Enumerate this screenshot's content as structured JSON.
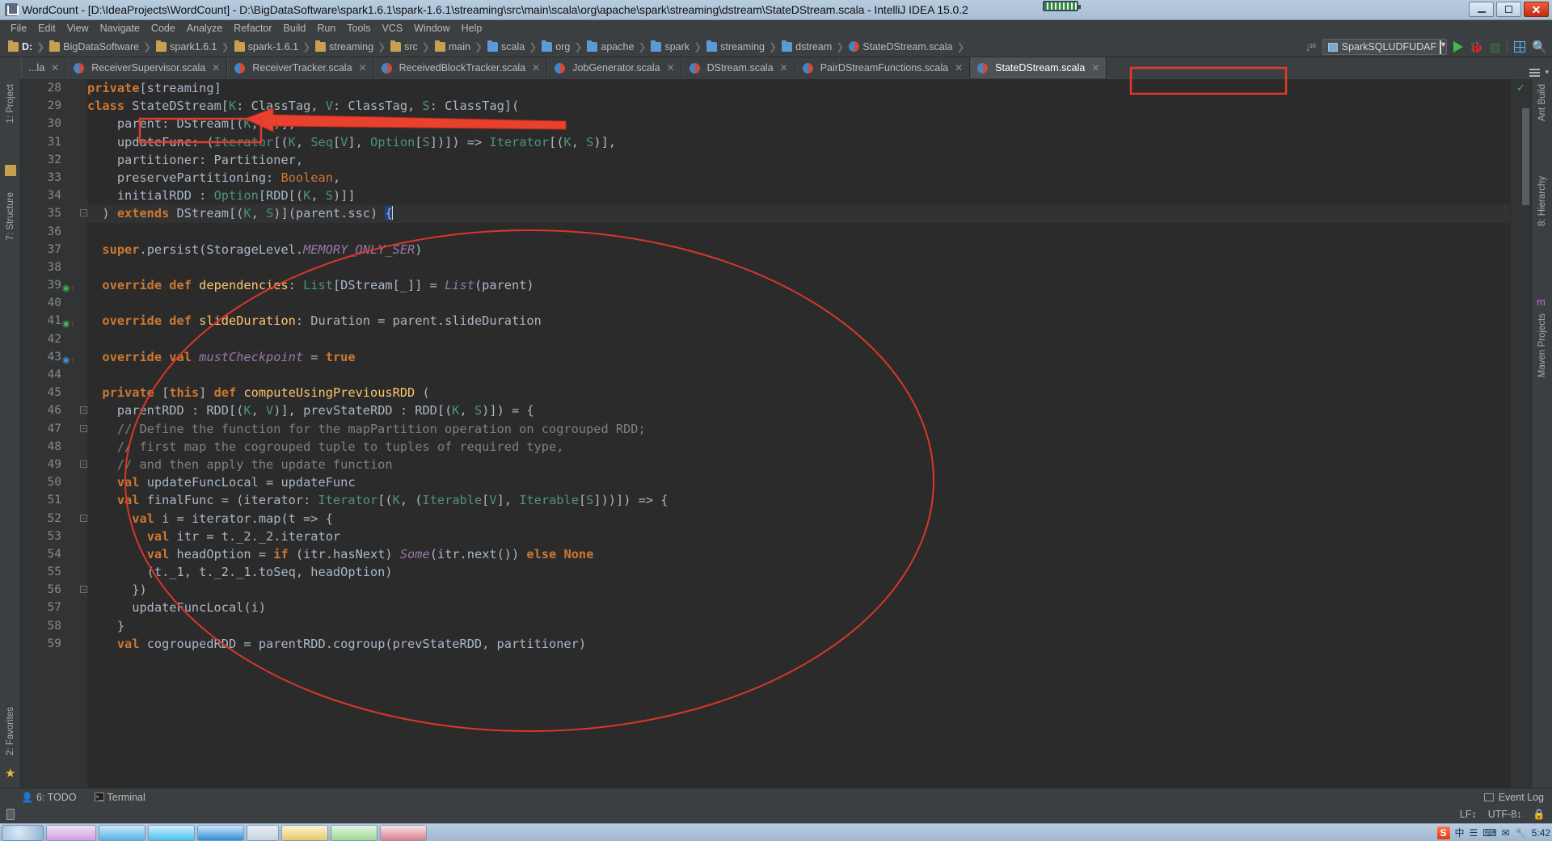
{
  "window": {
    "title": "WordCount - [D:\\IdeaProjects\\WordCount] - D:\\BigDataSoftware\\spark1.6.1\\spark-1.6.1\\streaming\\src\\main\\scala\\org\\apache\\spark\\streaming\\dstream\\StateDStream.scala - IntelliJ IDEA 15.0.2",
    "minimize_label": "Minimize",
    "maximize_label": "Maximize",
    "close_label": "Close"
  },
  "menubar": [
    {
      "label": "File"
    },
    {
      "label": "Edit"
    },
    {
      "label": "View"
    },
    {
      "label": "Navigate"
    },
    {
      "label": "Code"
    },
    {
      "label": "Analyze"
    },
    {
      "label": "Refactor"
    },
    {
      "label": "Build"
    },
    {
      "label": "Run"
    },
    {
      "label": "Tools"
    },
    {
      "label": "VCS"
    },
    {
      "label": "Window"
    },
    {
      "label": "Help"
    }
  ],
  "breadcrumbs": [
    {
      "label": "D:",
      "icon": "folder-icon",
      "kind": "folder"
    },
    {
      "label": "BigDataSoftware",
      "icon": "folder-icon",
      "kind": "folder"
    },
    {
      "label": "spark1.6.1",
      "icon": "folder-icon",
      "kind": "folder"
    },
    {
      "label": "spark-1.6.1",
      "icon": "folder-icon",
      "kind": "folder"
    },
    {
      "label": "streaming",
      "icon": "folder-icon",
      "kind": "folder"
    },
    {
      "label": "src",
      "icon": "folder-icon",
      "kind": "folder"
    },
    {
      "label": "main",
      "icon": "folder-icon",
      "kind": "folder"
    },
    {
      "label": "scala",
      "icon": "source-folder-icon",
      "kind": "src"
    },
    {
      "label": "org",
      "icon": "source-folder-icon",
      "kind": "src"
    },
    {
      "label": "apache",
      "icon": "source-folder-icon",
      "kind": "src"
    },
    {
      "label": "spark",
      "icon": "source-folder-icon",
      "kind": "src"
    },
    {
      "label": "streaming",
      "icon": "source-folder-icon",
      "kind": "src"
    },
    {
      "label": "dstream",
      "icon": "source-folder-icon",
      "kind": "src"
    },
    {
      "label": "StateDStream.scala",
      "icon": "scala-file-icon",
      "kind": "scala"
    }
  ],
  "toolbar": {
    "download_label": "10",
    "run_config": "SparkSQLUDFUDAF",
    "run_label": "Run",
    "debug_label": "Debug",
    "coverage_label": "Run with Coverage",
    "layout_label": "Toggle Layout",
    "search_label": "Search Everywhere"
  },
  "tabs": [
    {
      "label": "...la",
      "active": false,
      "truncated": true
    },
    {
      "label": "ReceiverSupervisor.scala",
      "active": false
    },
    {
      "label": "ReceiverTracker.scala",
      "active": false
    },
    {
      "label": "ReceivedBlockTracker.scala",
      "active": false
    },
    {
      "label": "JobGenerator.scala",
      "active": false
    },
    {
      "label": "DStream.scala",
      "active": false
    },
    {
      "label": "PairDStreamFunctions.scala",
      "active": false
    },
    {
      "label": "StateDStream.scala",
      "active": true
    }
  ],
  "left_tool_window": [
    {
      "label": "1: Project"
    },
    {
      "label": "7: Structure"
    },
    {
      "label": "2: Favorites"
    }
  ],
  "right_tool_window": [
    {
      "label": "Ant Build"
    },
    {
      "label": "8: Hierarchy"
    },
    {
      "label": "Maven Projects"
    }
  ],
  "editor": {
    "first_line": 28,
    "cursor_line": 35,
    "lines": [
      {
        "n": 28,
        "mark": "",
        "fold": "",
        "tokens": [
          {
            "t": "private",
            "c": "kw"
          },
          {
            "t": "[streaming]",
            "c": "pl"
          }
        ]
      },
      {
        "n": 29,
        "mark": "",
        "fold": "",
        "tokens": [
          {
            "t": "class ",
            "c": "kw"
          },
          {
            "t": "StateDStream",
            "c": "pl"
          },
          {
            "t": "[",
            "c": "pl"
          },
          {
            "t": "K",
            "c": "ty"
          },
          {
            "t": ": ClassTag, ",
            "c": "pl"
          },
          {
            "t": "V",
            "c": "ty"
          },
          {
            "t": ": ClassTag, ",
            "c": "pl"
          },
          {
            "t": "S",
            "c": "ty"
          },
          {
            "t": ": ClassTag](",
            "c": "pl"
          }
        ]
      },
      {
        "n": 30,
        "mark": "",
        "fold": "",
        "tokens": [
          {
            "t": "    parent: DStream[(",
            "c": "pl"
          },
          {
            "t": "K",
            "c": "ty"
          },
          {
            "t": ", ",
            "c": "pl"
          },
          {
            "t": "V",
            "c": "ty"
          },
          {
            "t": ")],",
            "c": "pl"
          }
        ]
      },
      {
        "n": 31,
        "mark": "",
        "fold": "",
        "tokens": [
          {
            "t": "    updateFunc: (",
            "c": "pl"
          },
          {
            "t": "Iterator",
            "c": "ty"
          },
          {
            "t": "[(",
            "c": "pl"
          },
          {
            "t": "K",
            "c": "ty"
          },
          {
            "t": ", ",
            "c": "pl"
          },
          {
            "t": "Seq",
            "c": "ty"
          },
          {
            "t": "[",
            "c": "pl"
          },
          {
            "t": "V",
            "c": "ty"
          },
          {
            "t": "], ",
            "c": "pl"
          },
          {
            "t": "Option",
            "c": "ty"
          },
          {
            "t": "[",
            "c": "pl"
          },
          {
            "t": "S",
            "c": "ty"
          },
          {
            "t": "])]) => ",
            "c": "pl"
          },
          {
            "t": "Iterator",
            "c": "ty"
          },
          {
            "t": "[(",
            "c": "pl"
          },
          {
            "t": "K",
            "c": "ty"
          },
          {
            "t": ", ",
            "c": "pl"
          },
          {
            "t": "S",
            "c": "ty"
          },
          {
            "t": ")],",
            "c": "pl"
          }
        ]
      },
      {
        "n": 32,
        "mark": "",
        "fold": "",
        "tokens": [
          {
            "t": "    partitioner: Partitioner,",
            "c": "pl"
          }
        ]
      },
      {
        "n": 33,
        "mark": "",
        "fold": "",
        "tokens": [
          {
            "t": "    preservePartitioning: ",
            "c": "pl"
          },
          {
            "t": "Boolean",
            "c": "kw2"
          },
          {
            "t": ",",
            "c": "pl"
          }
        ]
      },
      {
        "n": 34,
        "mark": "",
        "fold": "",
        "tokens": [
          {
            "t": "    initialRDD : ",
            "c": "pl"
          },
          {
            "t": "Option",
            "c": "ty"
          },
          {
            "t": "[RDD[(",
            "c": "pl"
          },
          {
            "t": "K",
            "c": "ty"
          },
          {
            "t": ", ",
            "c": "pl"
          },
          {
            "t": "S",
            "c": "ty"
          },
          {
            "t": ")]]",
            "c": "pl"
          }
        ]
      },
      {
        "n": 35,
        "mark": "",
        "fold": "minus",
        "tokens": [
          {
            "t": "  ) ",
            "c": "pl"
          },
          {
            "t": "extends",
            "c": "kw"
          },
          {
            "t": " DStream[(",
            "c": "pl"
          },
          {
            "t": "K",
            "c": "ty"
          },
          {
            "t": ", ",
            "c": "pl"
          },
          {
            "t": "S",
            "c": "ty"
          },
          {
            "t": ")](parent.ssc) ",
            "c": "pl"
          },
          {
            "t": "{",
            "c": "sel"
          }
        ]
      },
      {
        "n": 36,
        "mark": "",
        "fold": "",
        "tokens": []
      },
      {
        "n": 37,
        "mark": "",
        "fold": "",
        "tokens": [
          {
            "t": "  ",
            "c": "pl"
          },
          {
            "t": "super",
            "c": "kw"
          },
          {
            "t": ".persist(StorageLevel.",
            "c": "pl"
          },
          {
            "t": "MEMORY_ONLY_SER",
            "c": "fld"
          },
          {
            "t": ")",
            "c": "pl"
          }
        ]
      },
      {
        "n": 38,
        "mark": "",
        "fold": "",
        "tokens": []
      },
      {
        "n": 39,
        "mark": "override",
        "fold": "",
        "tokens": [
          {
            "t": "  ",
            "c": "pl"
          },
          {
            "t": "override def",
            "c": "kw"
          },
          {
            "t": " ",
            "c": "pl"
          },
          {
            "t": "dependencies",
            "c": "fn"
          },
          {
            "t": ": ",
            "c": "pl"
          },
          {
            "t": "List",
            "c": "ty"
          },
          {
            "t": "[DStream[_]] = ",
            "c": "pl"
          },
          {
            "t": "List",
            "c": "obj"
          },
          {
            "t": "(parent)",
            "c": "pl"
          }
        ]
      },
      {
        "n": 40,
        "mark": "",
        "fold": "",
        "tokens": []
      },
      {
        "n": 41,
        "mark": "override",
        "fold": "",
        "tokens": [
          {
            "t": "  ",
            "c": "pl"
          },
          {
            "t": "override def",
            "c": "kw"
          },
          {
            "t": " ",
            "c": "pl"
          },
          {
            "t": "slideDuration",
            "c": "fn"
          },
          {
            "t": ": Duration = parent.slideDuration",
            "c": "pl"
          }
        ]
      },
      {
        "n": 42,
        "mark": "",
        "fold": "",
        "tokens": []
      },
      {
        "n": 43,
        "mark": "override-val",
        "fold": "",
        "tokens": [
          {
            "t": "  ",
            "c": "pl"
          },
          {
            "t": "override val",
            "c": "kw"
          },
          {
            "t": " ",
            "c": "pl"
          },
          {
            "t": "mustCheckpoint",
            "c": "fld"
          },
          {
            "t": " = ",
            "c": "pl"
          },
          {
            "t": "true",
            "c": "kw"
          }
        ]
      },
      {
        "n": 44,
        "mark": "",
        "fold": "",
        "tokens": []
      },
      {
        "n": 45,
        "mark": "",
        "fold": "",
        "tokens": [
          {
            "t": "  ",
            "c": "pl"
          },
          {
            "t": "private",
            "c": "kw"
          },
          {
            "t": " [",
            "c": "pl"
          },
          {
            "t": "this",
            "c": "kw"
          },
          {
            "t": "] ",
            "c": "pl"
          },
          {
            "t": "def",
            "c": "kw"
          },
          {
            "t": " ",
            "c": "pl"
          },
          {
            "t": "computeUsingPreviousRDD",
            "c": "fn"
          },
          {
            "t": " (",
            "c": "pl"
          }
        ]
      },
      {
        "n": 46,
        "mark": "",
        "fold": "minus",
        "tokens": [
          {
            "t": "    parentRDD : RDD[(",
            "c": "pl"
          },
          {
            "t": "K",
            "c": "ty"
          },
          {
            "t": ", ",
            "c": "pl"
          },
          {
            "t": "V",
            "c": "ty"
          },
          {
            "t": ")], prevStateRDD : RDD[(",
            "c": "pl"
          },
          {
            "t": "K",
            "c": "ty"
          },
          {
            "t": ", ",
            "c": "pl"
          },
          {
            "t": "S",
            "c": "ty"
          },
          {
            "t": ")]) = {",
            "c": "pl"
          }
        ]
      },
      {
        "n": 47,
        "mark": "",
        "fold": "minus",
        "tokens": [
          {
            "t": "    // Define the function for the mapPartition operation on cogrouped RDD;",
            "c": "cm"
          }
        ]
      },
      {
        "n": 48,
        "mark": "",
        "fold": "",
        "tokens": [
          {
            "t": "    // first map the cogrouped tuple to tuples of required type,",
            "c": "cm"
          }
        ]
      },
      {
        "n": 49,
        "mark": "",
        "fold": "minus",
        "tokens": [
          {
            "t": "    // and then apply the update function",
            "c": "cm"
          }
        ]
      },
      {
        "n": 50,
        "mark": "",
        "fold": "",
        "tokens": [
          {
            "t": "    ",
            "c": "pl"
          },
          {
            "t": "val",
            "c": "kw"
          },
          {
            "t": " updateFuncLocal = updateFunc",
            "c": "pl"
          }
        ]
      },
      {
        "n": 51,
        "mark": "",
        "fold": "",
        "tokens": [
          {
            "t": "    ",
            "c": "pl"
          },
          {
            "t": "val",
            "c": "kw"
          },
          {
            "t": " finalFunc = (iterator: ",
            "c": "pl"
          },
          {
            "t": "Iterator",
            "c": "ty"
          },
          {
            "t": "[(",
            "c": "pl"
          },
          {
            "t": "K",
            "c": "ty"
          },
          {
            "t": ", (",
            "c": "pl"
          },
          {
            "t": "Iterable",
            "c": "ty"
          },
          {
            "t": "[",
            "c": "pl"
          },
          {
            "t": "V",
            "c": "ty"
          },
          {
            "t": "], ",
            "c": "pl"
          },
          {
            "t": "Iterable",
            "c": "ty"
          },
          {
            "t": "[",
            "c": "pl"
          },
          {
            "t": "S",
            "c": "ty"
          },
          {
            "t": "]))]) => {",
            "c": "pl"
          }
        ]
      },
      {
        "n": 52,
        "mark": "",
        "fold": "minus",
        "tokens": [
          {
            "t": "      ",
            "c": "pl"
          },
          {
            "t": "val",
            "c": "kw"
          },
          {
            "t": " i = iterator.map(t => {",
            "c": "pl"
          }
        ]
      },
      {
        "n": 53,
        "mark": "",
        "fold": "",
        "tokens": [
          {
            "t": "        ",
            "c": "pl"
          },
          {
            "t": "val",
            "c": "kw"
          },
          {
            "t": " itr = t._2._2.iterator",
            "c": "pl"
          }
        ]
      },
      {
        "n": 54,
        "mark": "",
        "fold": "",
        "tokens": [
          {
            "t": "        ",
            "c": "pl"
          },
          {
            "t": "val",
            "c": "kw"
          },
          {
            "t": " headOption = ",
            "c": "pl"
          },
          {
            "t": "if",
            "c": "kw"
          },
          {
            "t": " (itr.hasNext) ",
            "c": "pl"
          },
          {
            "t": "Some",
            "c": "obj"
          },
          {
            "t": "(itr.next()) ",
            "c": "pl"
          },
          {
            "t": "else",
            "c": "kw"
          },
          {
            "t": " ",
            "c": "pl"
          },
          {
            "t": "None",
            "c": "kw"
          }
        ]
      },
      {
        "n": 55,
        "mark": "",
        "fold": "",
        "tokens": [
          {
            "t": "        (t._1, t._2._1.toSeq, headOption)",
            "c": "pl"
          }
        ]
      },
      {
        "n": 56,
        "mark": "",
        "fold": "minus",
        "tokens": [
          {
            "t": "      })",
            "c": "pl"
          }
        ]
      },
      {
        "n": 57,
        "mark": "",
        "fold": "",
        "tokens": [
          {
            "t": "      updateFuncLocal(i)",
            "c": "pl"
          }
        ]
      },
      {
        "n": 58,
        "mark": "",
        "fold": "",
        "tokens": [
          {
            "t": "    }",
            "c": "pl"
          }
        ]
      },
      {
        "n": 59,
        "mark": "",
        "fold": "",
        "tokens": [
          {
            "t": "    ",
            "c": "pl"
          },
          {
            "t": "val",
            "c": "kw"
          },
          {
            "t": " cogroupedRDD = parentRDD.cogroup(prevStateRDD, partitioner)",
            "c": "pl"
          }
        ]
      }
    ]
  },
  "bottom_bar": {
    "todo_label": "6: TODO",
    "terminal_label": "Terminal",
    "event_log_label": "Event Log"
  },
  "status_bar": {
    "line_sep": "LF↕",
    "encoding": "UTF-8↕",
    "lock_label": "lock-icon"
  },
  "taskbar": {
    "tray_ime": "中",
    "tray_clock": "5:42",
    "tray_s": "S"
  },
  "annotations": {
    "accent_color": "#e03b2b",
    "arrow": "points-left-to-StateDStream",
    "rect_class_name": "StateDStream",
    "rect_tab": "StateDStream.scala",
    "ellipse": "method-body-highlight"
  }
}
